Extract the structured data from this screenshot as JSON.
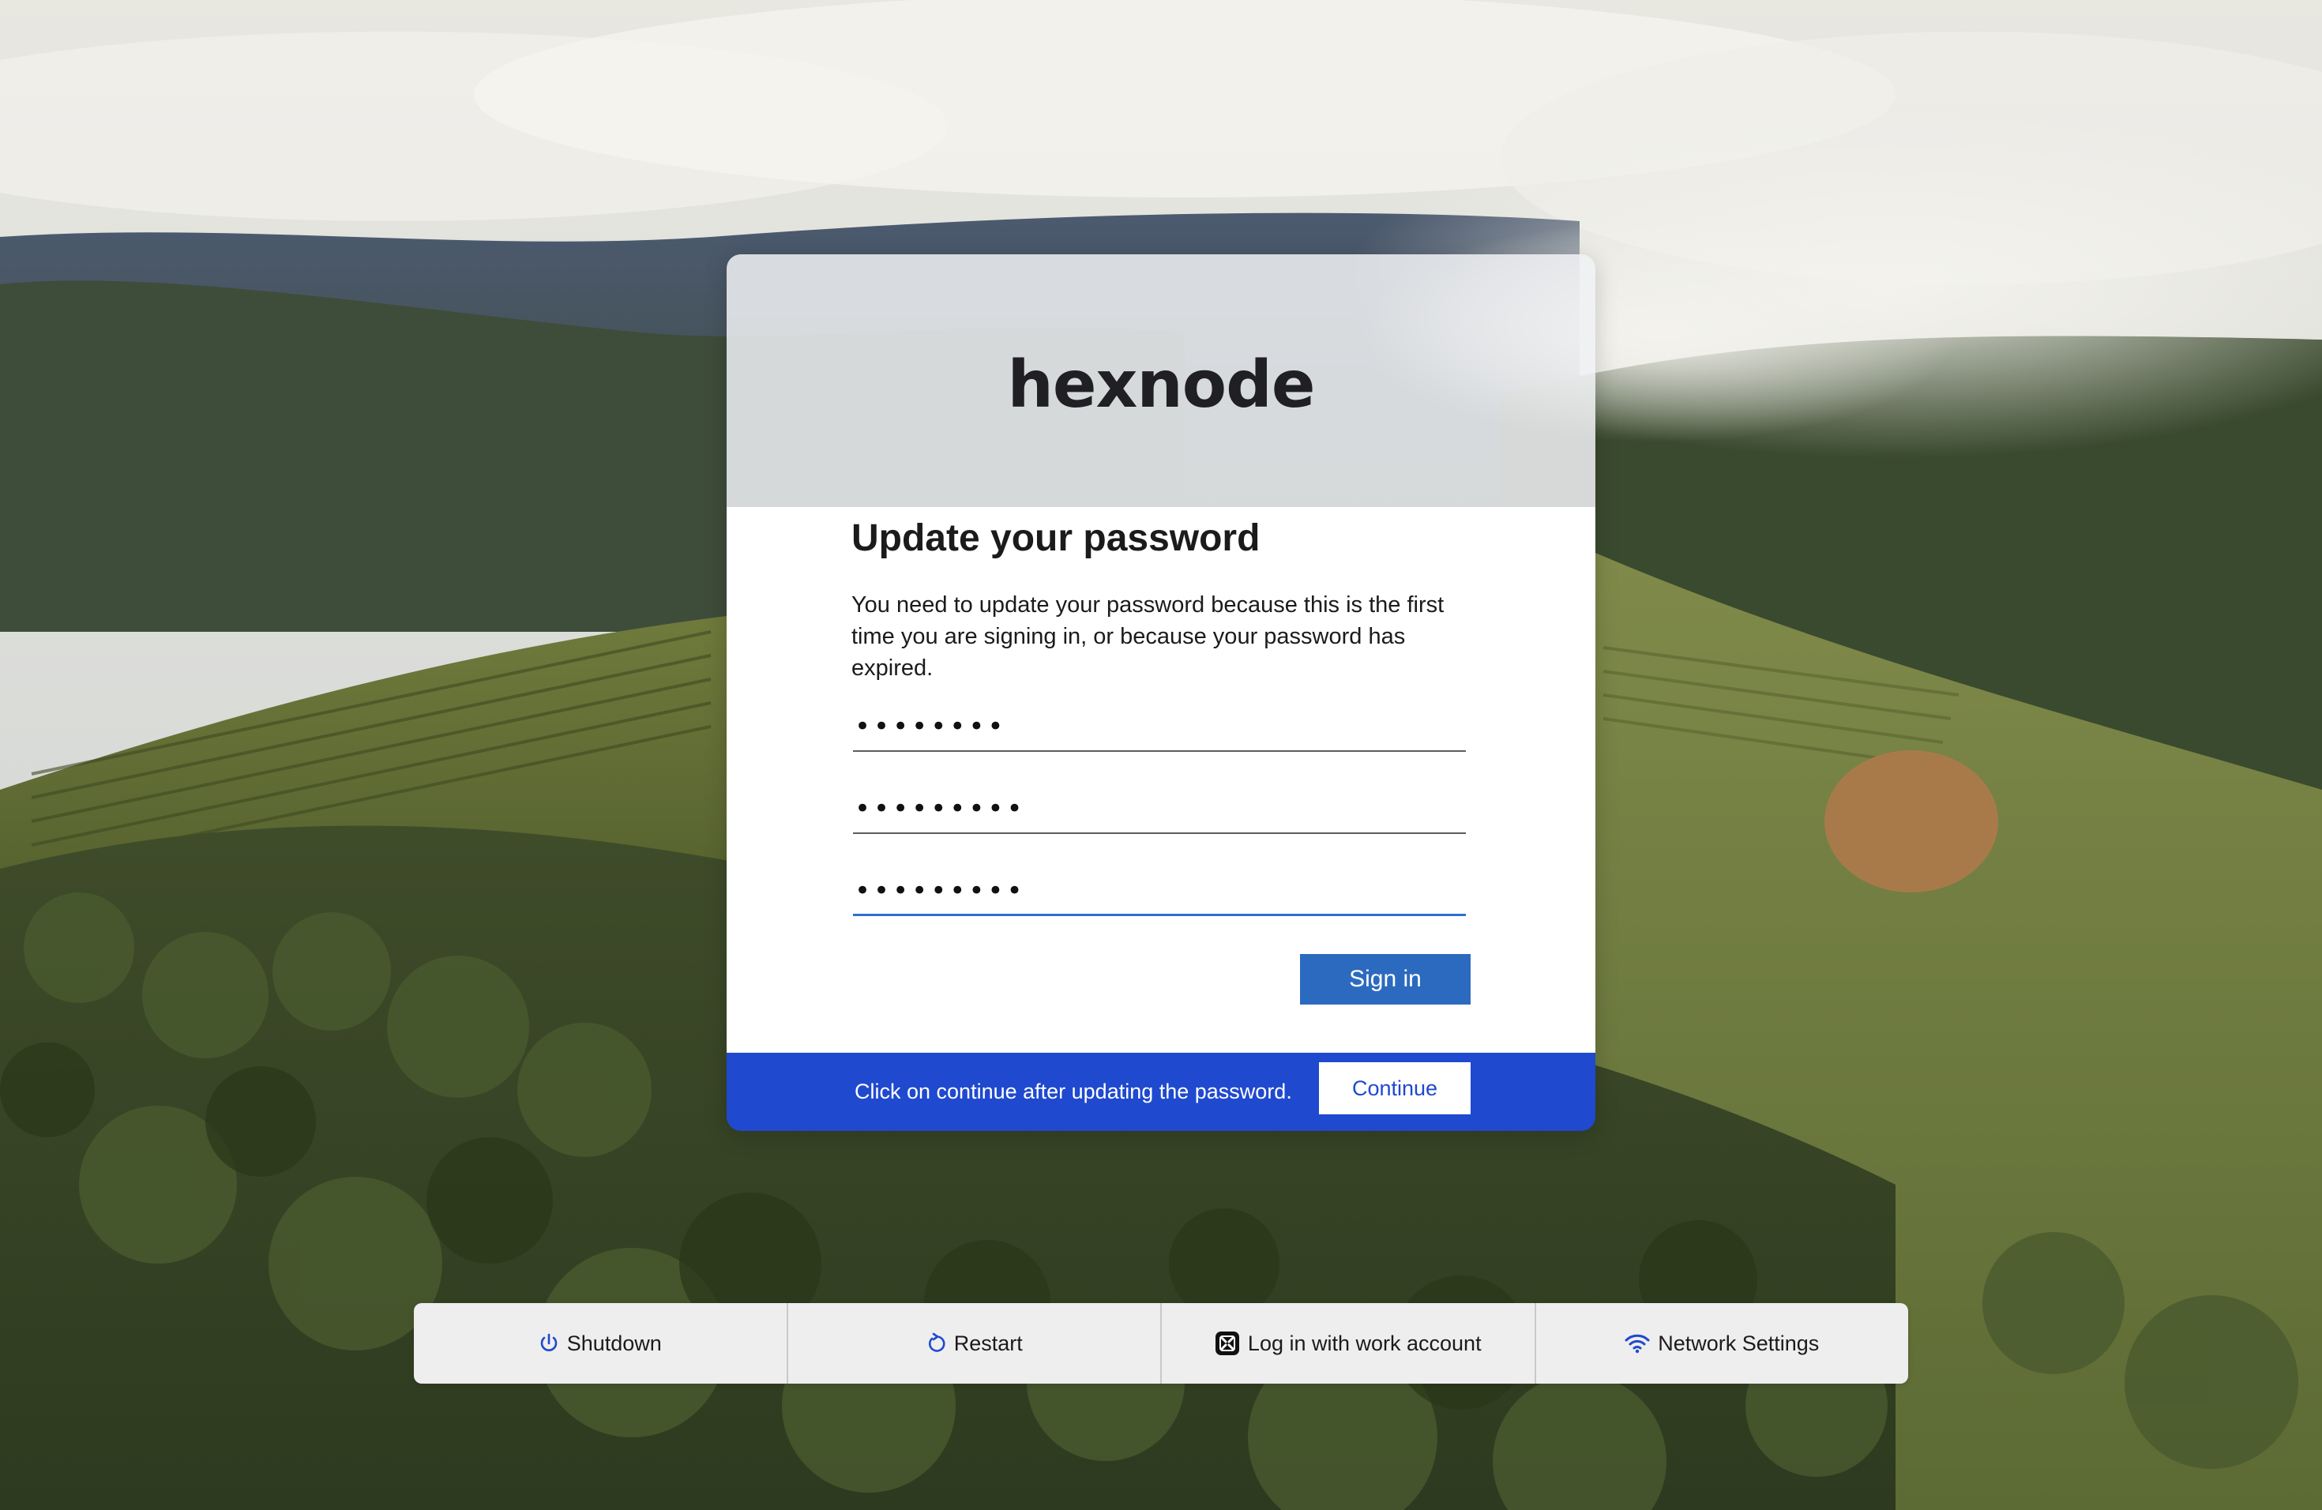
{
  "logo": {
    "text": "hexnode"
  },
  "form": {
    "title": "Update your password",
    "description": "You need to update your password because this is the first time you are signing in, or because your password has expired.",
    "password_fields": [
      {
        "value": "••••••••"
      },
      {
        "value": "•••••••••"
      },
      {
        "value": "•••••••••"
      }
    ],
    "signin_label": "Sign in"
  },
  "footer": {
    "text": "Click on continue after updating the password.",
    "continue_label": "Continue"
  },
  "actions": [
    {
      "label": "Shutdown",
      "icon": "power-icon"
    },
    {
      "label": "Restart",
      "icon": "restart-icon"
    },
    {
      "label": "Log in with work account",
      "icon": "work-account-icon"
    },
    {
      "label": "Network Settings",
      "icon": "wifi-icon"
    }
  ],
  "colors": {
    "primary_button": "#2c6ac0",
    "footer_bar": "#1f49cf",
    "icon_blue": "#1f49cf"
  }
}
